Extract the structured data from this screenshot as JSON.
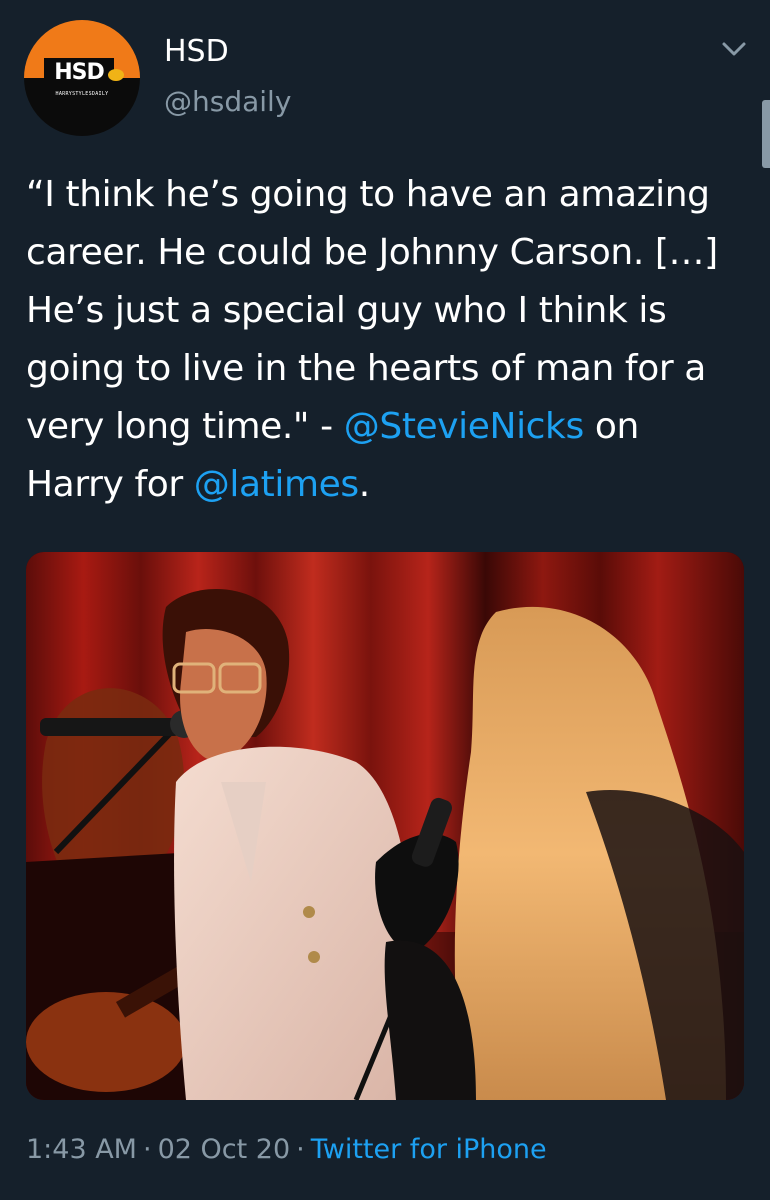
{
  "tweet": {
    "avatar": {
      "logo_text": "HSD",
      "sub_text": "HARRYSTYLESDAILY",
      "colors": {
        "top": "#f07a18",
        "bottom": "#0b0b0b"
      }
    },
    "display_name": "HSD",
    "handle": "@hsdaily",
    "menu_icon": "chevron-down-icon",
    "text_parts": {
      "part1": "“I think he’s going to have an amazing career. He could be Johnny Carson. […] He’s just a special guy who I think is going to live in the hearts of man for a very long time.\" - ",
      "mention1": "@StevieNicks",
      "part2": " on Harry for ",
      "mention2": "@latimes",
      "part3": "."
    },
    "meta": {
      "time": "1:43 AM",
      "date": "02 Oct 20",
      "separator": "·",
      "source": "Twitter for iPhone"
    }
  },
  "colors": {
    "background": "#15202b",
    "text": "#ffffff",
    "secondary_text": "#8899a6",
    "link": "#1da1f2"
  }
}
